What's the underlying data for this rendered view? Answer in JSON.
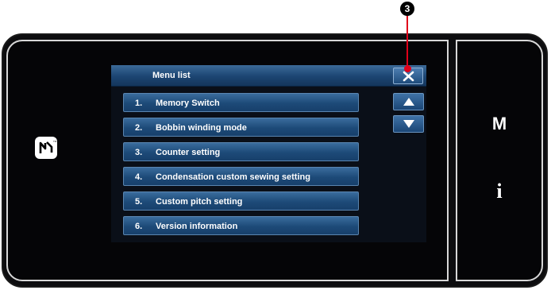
{
  "window": {
    "title": "Menu list"
  },
  "menu": {
    "items": [
      {
        "number": "1.",
        "label": "Memory Switch"
      },
      {
        "number": "2.",
        "label": "Bobbin winding mode"
      },
      {
        "number": "3.",
        "label": "Counter setting"
      },
      {
        "number": "4.",
        "label": "Condensation custom sewing setting"
      },
      {
        "number": "5.",
        "label": "Custom pitch setting"
      },
      {
        "number": "6.",
        "label": "Version information"
      }
    ]
  },
  "side_panel": {
    "m_key_label": "M",
    "info_key_label": "i"
  },
  "callout": {
    "label": "3"
  },
  "icons": {
    "close": "close-icon",
    "scroll_up": "triangle-up-icon",
    "scroll_down": "triangle-down-icon",
    "nfc": "nfc-icon"
  },
  "colors": {
    "accent_blue": "#1d4a78",
    "callout_red": "#e0001a",
    "bezel": "#0d0d0f"
  }
}
